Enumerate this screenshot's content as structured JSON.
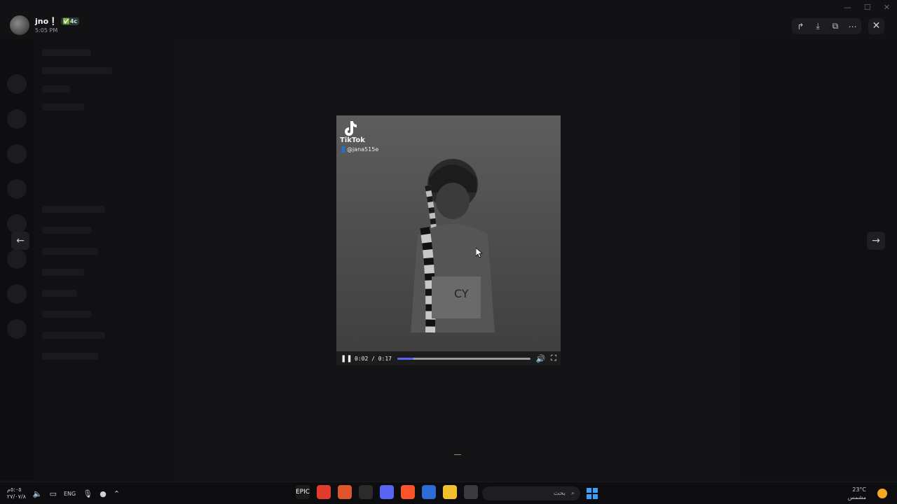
{
  "header": {
    "user_name": "jno❕",
    "user_tag": "✅4c",
    "timestamp": "5:05 PM",
    "toolbar": [
      {
        "name": "forward-icon",
        "glyph": "↱"
      },
      {
        "name": "download-icon",
        "glyph": "⤓"
      },
      {
        "name": "open-external-icon",
        "glyph": "⧉"
      },
      {
        "name": "more-icon",
        "glyph": "⋯"
      }
    ],
    "close_glyph": "✕",
    "window_controls": [
      "—",
      "☐",
      "✕"
    ]
  },
  "navigation": {
    "prev_glyph": "←",
    "next_glyph": "→"
  },
  "video": {
    "brand": "TikTok",
    "username": "👤@jana515e",
    "current_time": "0:02",
    "duration": "0:17",
    "time_display": "0:02 / 0:17",
    "progress": 0.12,
    "pause_glyph": "❚❚",
    "volume_glyph": "🔊",
    "fullscreen_glyph": "⛶"
  },
  "taskbar": {
    "clock_time": "٥:٠٥م",
    "clock_date": "٢٧/٠٧/٨",
    "language": "ENG",
    "search_placeholder": "بحث",
    "weather_temp": "23°C",
    "weather_desc": "مشمس",
    "apps": [
      {
        "name": "epic-games-icon",
        "label": "EPIC",
        "bg": "#1b1b1b"
      },
      {
        "name": "chrome-icon",
        "label": "",
        "bg": "#e33b2e"
      },
      {
        "name": "app-orange-icon",
        "label": "",
        "bg": "#e0552b"
      },
      {
        "name": "app-clock-icon",
        "label": "",
        "bg": "#2b2b2b"
      },
      {
        "name": "discord-icon",
        "label": "",
        "bg": "#5865f2"
      },
      {
        "name": "brave-icon",
        "label": "",
        "bg": "#fb542b"
      },
      {
        "name": "store-icon",
        "label": "",
        "bg": "#2d6bd6"
      },
      {
        "name": "file-explorer-icon",
        "label": "",
        "bg": "#f2c02c"
      },
      {
        "name": "app-window-icon",
        "label": "",
        "bg": "#3a3a3e"
      }
    ]
  },
  "colors": {
    "accent": "#5865f2",
    "background": "#121214"
  }
}
